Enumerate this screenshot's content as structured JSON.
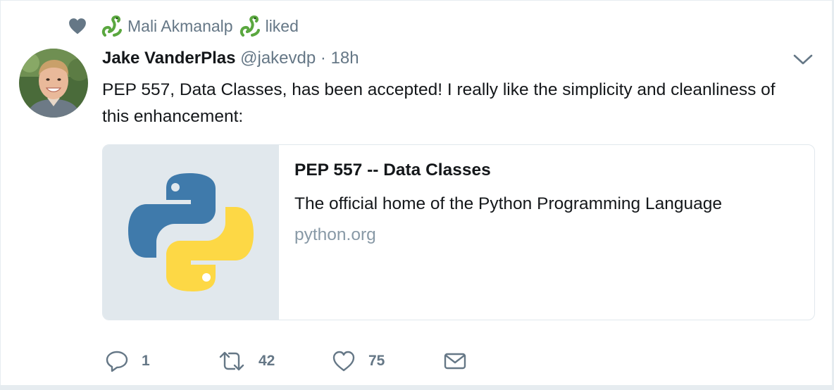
{
  "context": {
    "icon": "heart-icon",
    "liker_name": "Mali Akmanalp",
    "action": "liked"
  },
  "tweet": {
    "author_name": "Jake VanderPlas",
    "author_handle": "@jakevdp",
    "separator": "·",
    "time": "18h",
    "text": "PEP 557, Data Classes, has been accepted! I really like the simplicity and cleanliness of this enhancement:"
  },
  "card": {
    "title": "PEP 557 -- Data Classes",
    "description": "The official home of the Python Programming Language",
    "domain": "python.org"
  },
  "actions": {
    "reply_count": "1",
    "retweet_count": "42",
    "like_count": "75"
  },
  "colors": {
    "muted": "#657786",
    "python_blue": "#3d79a8",
    "python_yellow": "#fcd541",
    "snake_green": "#5aa73f"
  }
}
